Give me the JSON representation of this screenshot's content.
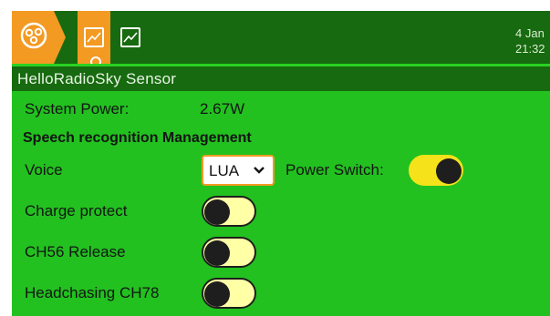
{
  "header": {
    "menu_icon": "radio-menu-icon",
    "tabs": [
      {
        "icon": "chart-line-icon",
        "active": true
      },
      {
        "icon": "chart-line-icon",
        "active": false
      }
    ],
    "date": "4 Jan",
    "time": "21:32"
  },
  "title": "HelloRadioSky Sensor",
  "system_power": {
    "label": "System Power:",
    "value": "2.67W"
  },
  "section_heading": "Speech recognition Management",
  "voice": {
    "label": "Voice",
    "selected": "LUA"
  },
  "power_switch": {
    "label": "Power Switch:",
    "on": true
  },
  "toggles": [
    {
      "label": "Charge protect",
      "on": false
    },
    {
      "label": "CH56 Release",
      "on": false
    },
    {
      "label": "Headchasing CH78",
      "on": false
    }
  ],
  "colors": {
    "background": "#22c11f",
    "header": "#176a0f",
    "accent": "#f39a22",
    "toggle_on": "#f6e21a",
    "toggle_off": "#ffffa6"
  }
}
